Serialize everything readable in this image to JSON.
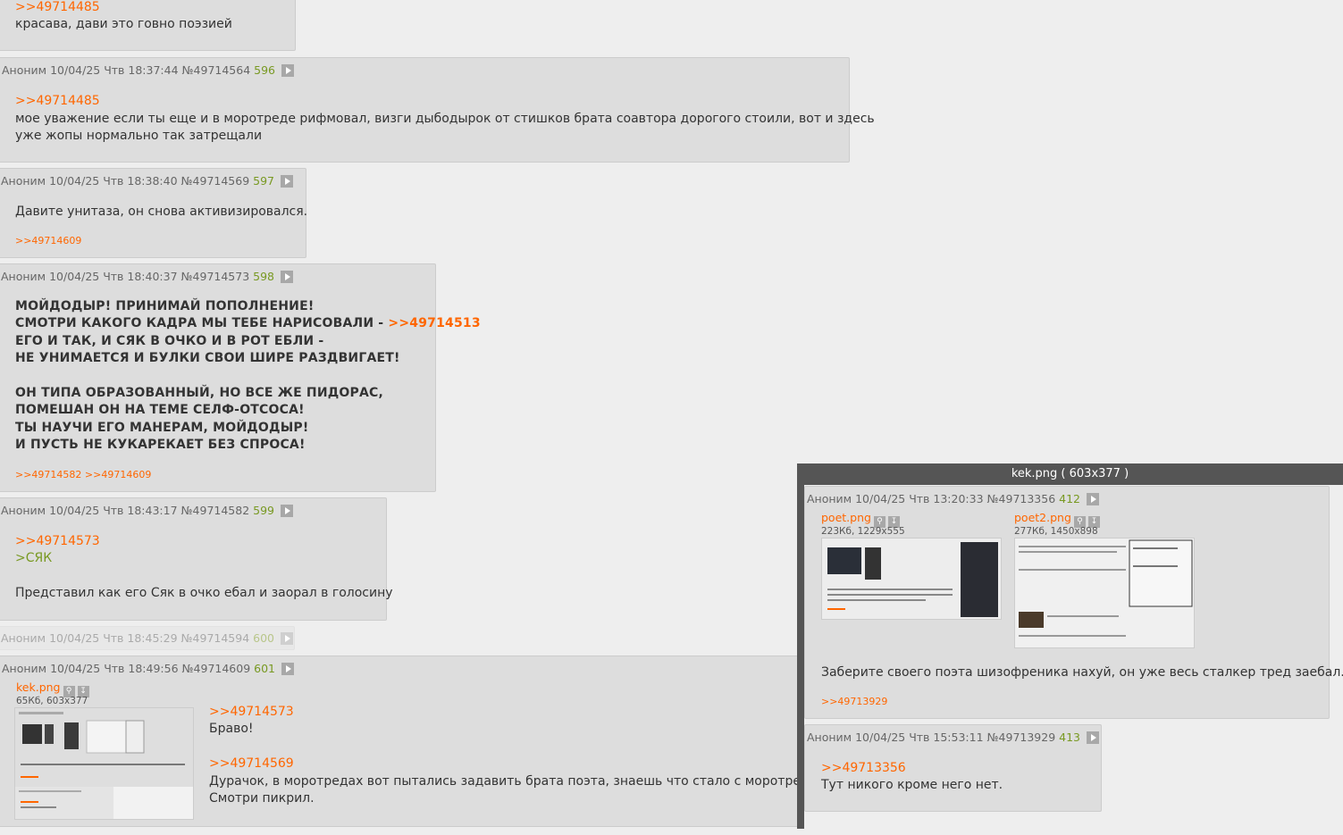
{
  "posts": [
    {
      "lines": [
        ">>49714485",
        "красава, дави это говно поэзией"
      ]
    },
    {
      "author": "Аноним",
      "date": "10/04/25 Чтв 18:37:44",
      "id": "№49714564",
      "num": "596",
      "reply_to": ">>49714485",
      "lines": [
        "мое уважение если ты еще и в моротреде рифмовал, визги дыбодырок от стишков брата соавтора дорогого стоили, вот и здесь",
        "уже жопы нормально так затрещали"
      ]
    },
    {
      "author": "Аноним",
      "date": "10/04/25 Чтв 18:38:40",
      "id": "№49714569",
      "num": "597",
      "lines": [
        "Давите унитаза, он снова активизировался."
      ],
      "replies": ">>49714609"
    },
    {
      "author": "Аноним",
      "date": "10/04/25 Чтв 18:40:37",
      "id": "№49714573",
      "num": "598",
      "lines": [
        "МОЙДОДЫР! ПРИНИМАЙ ПОПОЛНЕНИЕ!",
        "СМОТРИ КАКОГО КАДРА МЫ ТЕБЕ НАРИСОВАЛИ - ",
        "ЕГО И ТАК, И СЯК В ОЧКО И В РОТ ЕБЛИ -",
        "НЕ УНИМАЕТСЯ И БУЛКИ СВОИ ШИРЕ РАЗДВИГАЕТ!",
        "ОН ТИПА ОБРАЗОВАННЫЙ, НО ВСЕ ЖЕ ПИДОРАС,",
        "ПОМЕШАН ОН НА ТЕМЕ СЕЛФ-ОТСОСА!",
        "ТЫ НАУЧИ ЕГО МАНЕРАМ, МОЙДОДЫР!",
        "И ПУСТЬ НЕ КУКАРЕКАЕТ БЕЗ СПРОСА!"
      ],
      "inline_link": ">>49714513",
      "replies": ">>49714582 >>49714609"
    },
    {
      "author": "Аноним",
      "date": "10/04/25 Чтв 18:43:17",
      "id": "№49714582",
      "num": "599",
      "reply_to": ">>49714573",
      "greentext": ">СЯК",
      "lines": [
        "Представил как его Сяк в очко ебал и заорал в голосину"
      ]
    },
    {
      "author": "Аноним",
      "date": "10/04/25 Чтв 18:45:29",
      "id": "№49714594",
      "num": "600"
    },
    {
      "author": "Аноним",
      "date": "10/04/25 Чтв 18:49:56",
      "id": "№49714609",
      "num": "601",
      "file": {
        "name": "kek.png",
        "meta": "65Кб, 603x377"
      },
      "reply1": ">>49714573",
      "text1": "Браво!",
      "reply2": ">>49714569",
      "text2": "Дурачок, в моротредах вот пытались задавить брата поэта, знаешь что стало с моротредами?",
      "text3": "Смотри пикрил."
    }
  ],
  "popup": {
    "title": "kek.png ( 603x377 )",
    "post1": {
      "author": "Аноним",
      "date": "10/04/25 Чтв 13:20:33",
      "id": "№49713356",
      "num": "412",
      "file1": {
        "name": "poet.png",
        "meta": "223Кб, 1229x555"
      },
      "file2": {
        "name": "poet2.png",
        "meta": "277Кб, 1450x898"
      },
      "text": "Заберите своего поэта шизофреника нахуй, он уже весь сталкер тред заебал.",
      "replies": ">>49713929"
    },
    "post2": {
      "author": "Аноним",
      "date": "10/04/25 Чтв 15:53:11",
      "id": "№49713929",
      "num": "413",
      "reply_to": ">>49713356",
      "text": "Тут никого кроме него нет."
    }
  },
  "colors": {
    "link": "#ff6600",
    "post_num": "#789922",
    "post_bg": "#dddddd",
    "page_bg": "#eeeeee",
    "popup_frame": "#555555"
  },
  "icons": [
    "play-icon",
    "search-icon",
    "download-icon"
  ]
}
